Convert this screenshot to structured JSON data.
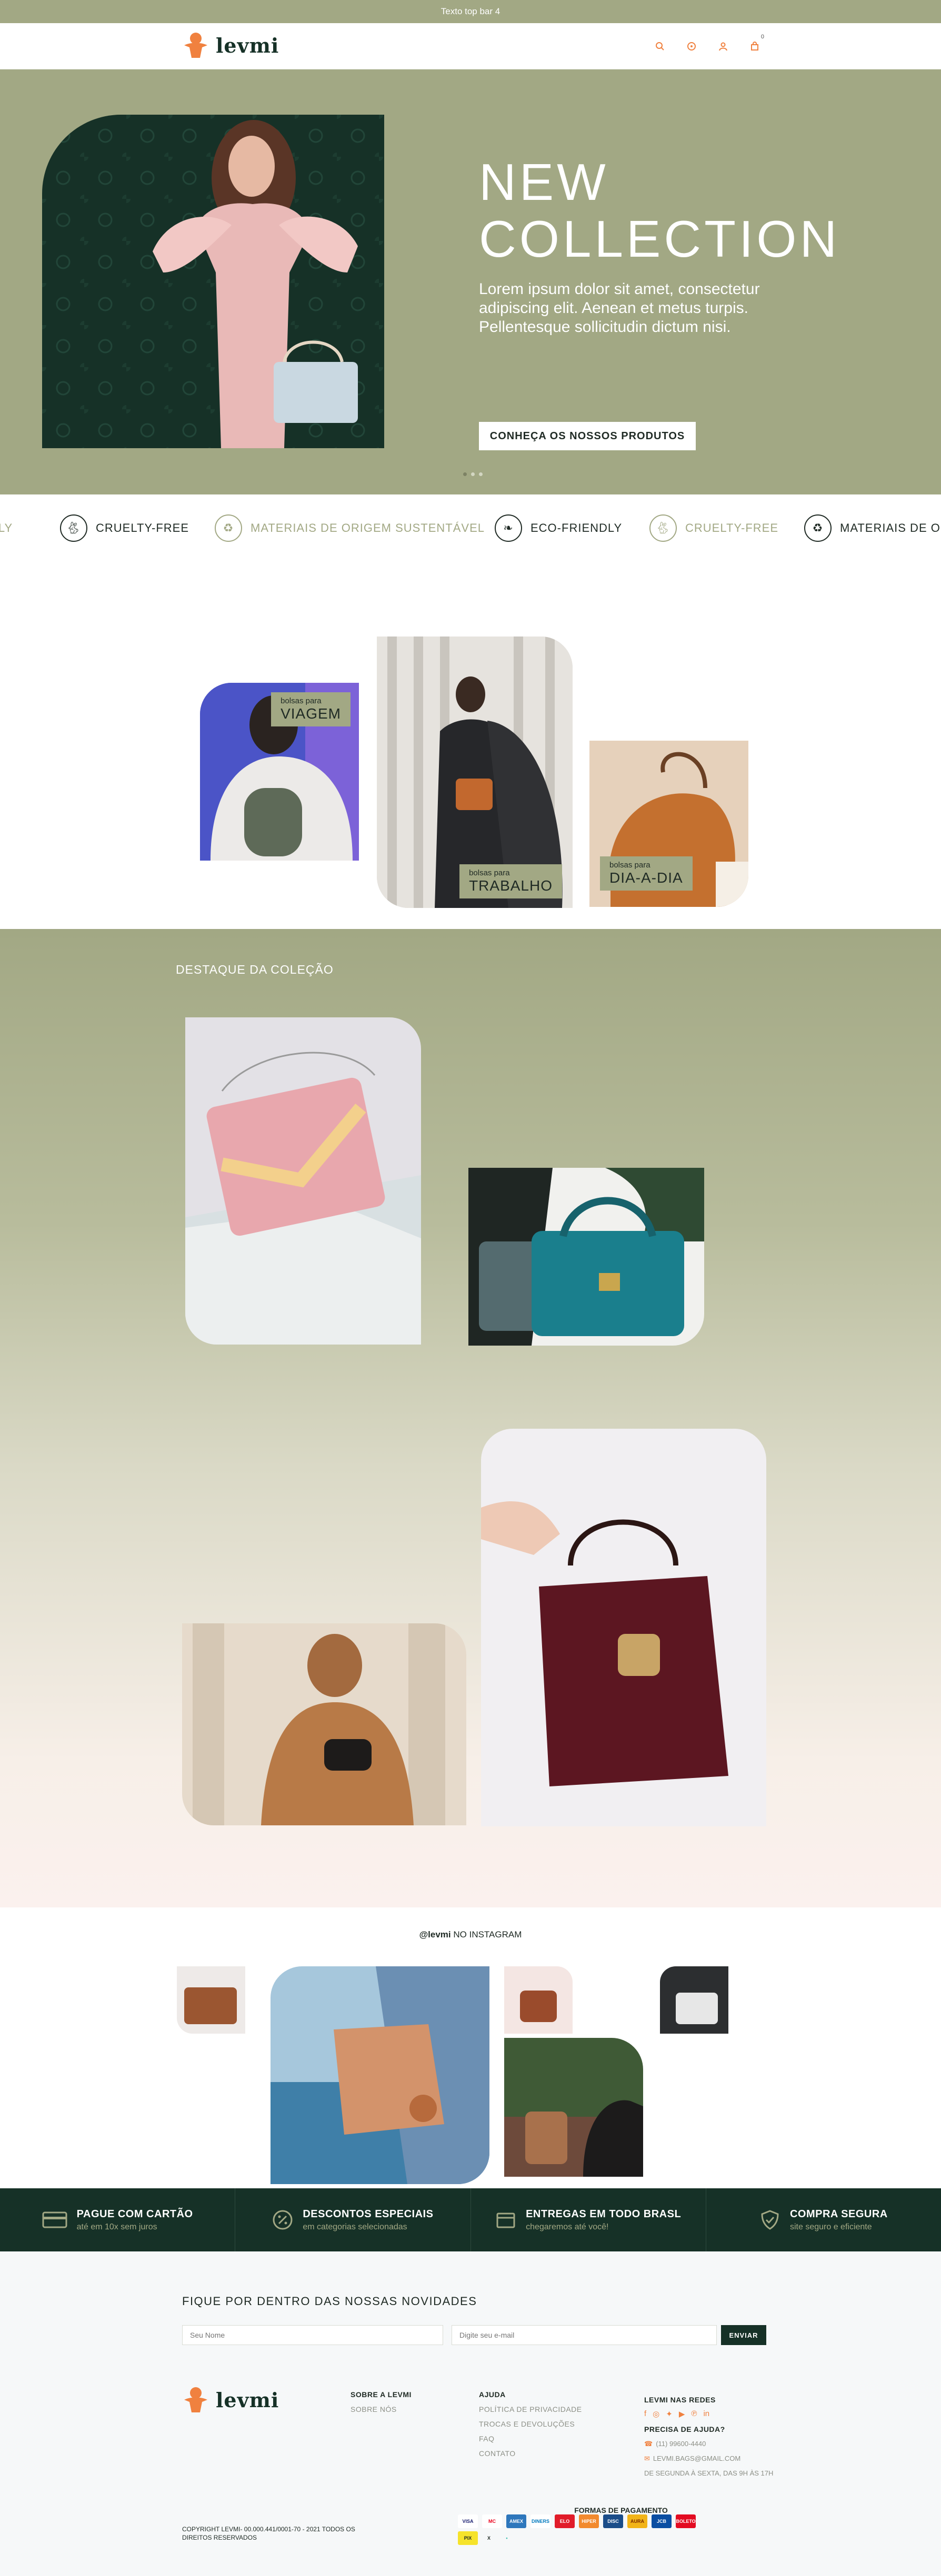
{
  "topbar": {
    "text": "Texto top bar 4"
  },
  "brand": {
    "name": "levmi",
    "accent": "#f0813f",
    "dark": "#163127",
    "sage": "#a2a884"
  },
  "header": {
    "icons": [
      "search-icon",
      "whatsapp-icon",
      "user-icon",
      "bag-icon"
    ],
    "cart_count": "0"
  },
  "hero": {
    "title_line1": "NEW",
    "title_line2": "COLLECTION",
    "text": "Lorem ipsum dolor sit amet, consectetur adipiscing elit. Aenean et metus turpis. Pellentesque sollicitudin dictum nisi.",
    "button": "CONHEÇA OS NOSSOS PRODUTOS",
    "slides_total": 3,
    "slide_active": 1
  },
  "marquee": [
    {
      "label": "DLY",
      "icon": "leaf-icon",
      "style": "light"
    },
    {
      "label": "CRUELTY-FREE",
      "icon": "rabbit-icon",
      "style": "dark"
    },
    {
      "label": "MATERIAIS DE ORIGEM SUSTENTÁVEL",
      "icon": "recycle-icon",
      "style": "light"
    },
    {
      "label": "ECO-FRIENDLY",
      "icon": "leaf-icon",
      "style": "dark"
    },
    {
      "label": "CRUELTY-FREE",
      "icon": "rabbit-icon",
      "style": "light"
    },
    {
      "label": "MATERIAIS DE ORIG",
      "icon": "recycle-icon",
      "style": "dark"
    }
  ],
  "categories": [
    {
      "small": "bolsas para",
      "big": "VIAGEM"
    },
    {
      "small": "bolsas para",
      "big": "TRABALHO"
    },
    {
      "small": "bolsas para",
      "big": "DIA-A-DIA"
    }
  ],
  "featured": {
    "title": "DESTAQUE DA COLEÇÃO"
  },
  "instagram": {
    "handle": "@levmi",
    "title": "NO INSTAGRAM"
  },
  "benefits": [
    {
      "title": "PAGUE COM CARTÃO",
      "sub": "até em 10x sem juros",
      "icon": "card-icon"
    },
    {
      "title": "DESCONTOS ESPECIAIS",
      "sub": "em categorias selecionadas",
      "icon": "percent-icon"
    },
    {
      "title": "ENTREGAS EM TODO BRASL",
      "sub": "chegaremos até você!",
      "icon": "box-icon"
    },
    {
      "title": "COMPRA SEGURA",
      "sub": "site seguro e eficiente",
      "icon": "shield-icon"
    }
  ],
  "newsletter": {
    "title": "FIQUE POR DENTRO DAS NOSSAS NOVIDADES",
    "name_placeholder": "Seu Nome",
    "email_placeholder": "Digite seu e-mail",
    "button": "ENVIAR"
  },
  "footer": {
    "about_head": "SOBRE A LEVMI",
    "about_links": [
      "SOBRE NÓS"
    ],
    "help_head": "AJUDA",
    "help_links": [
      "POLÍTICA DE PRIVACIDADE",
      "TROCAS E DEVOLUÇÕES",
      "FAQ",
      "CONTATO"
    ],
    "social_head": "LEVMI NAS REDES",
    "social_icons": [
      "facebook-icon",
      "instagram-icon",
      "twitter-icon",
      "youtube-icon",
      "pinterest-icon",
      "linkedin-icon"
    ],
    "need_help_head": "PRECISA DE AJUDA?",
    "phone": "(11) 99600-4440",
    "email": "LEVMI.BAGS@GMAIL.COM",
    "hours": "DE SEGUNDA À SEXTA, DAS 9H ÀS 17H",
    "payment_title": "FORMAS DE PAGAMENTO",
    "payments_row1": [
      "VISA",
      "MC",
      "AMEX",
      "DINERS",
      "ELO",
      "HIPER",
      "DISC",
      "AURA",
      "JCB",
      "BOLETO"
    ],
    "payments_row2": [
      "PIX",
      "X",
      "•"
    ],
    "copyright": "COPYRIGHT LEVMI- 00.000.441/0001-70 - 2021 TODOS OS DIREITOS RESERVADOS"
  }
}
